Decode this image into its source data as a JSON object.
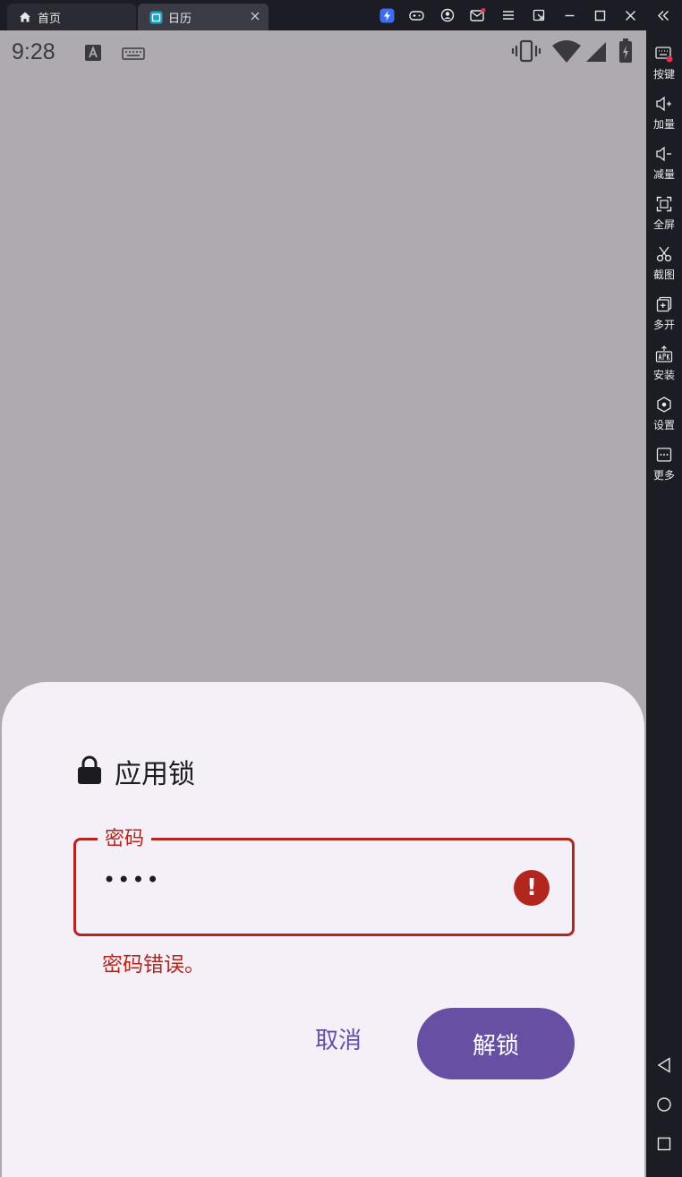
{
  "tabs": [
    {
      "label": "首页",
      "icon": "home-icon"
    },
    {
      "label": "日历",
      "icon": "calendar-app-icon"
    }
  ],
  "status": {
    "time": "9:28"
  },
  "dialog": {
    "title": "应用锁",
    "password_label": "密码",
    "password_value": "••••",
    "error_text": "密码错误。",
    "cancel_label": "取消",
    "unlock_label": "解锁"
  },
  "sidebar": {
    "items": [
      {
        "label": "按键",
        "icon": "keyboard-icon"
      },
      {
        "label": "加量",
        "icon": "volume-up-icon"
      },
      {
        "label": "减量",
        "icon": "volume-down-icon"
      },
      {
        "label": "全屏",
        "icon": "fullscreen-icon"
      },
      {
        "label": "截图",
        "icon": "scissors-icon"
      },
      {
        "label": "多开",
        "icon": "multi-instance-icon"
      },
      {
        "label": "安装",
        "icon": "apk-install-icon"
      },
      {
        "label": "设置",
        "icon": "settings-icon"
      },
      {
        "label": "更多",
        "icon": "more-icon"
      }
    ]
  },
  "colors": {
    "accent": "#6750a4",
    "error": "#b3261e",
    "sheet_bg": "#f5f0f7",
    "scrim": "#aeaaaf",
    "chrome": "#1b1c24"
  }
}
